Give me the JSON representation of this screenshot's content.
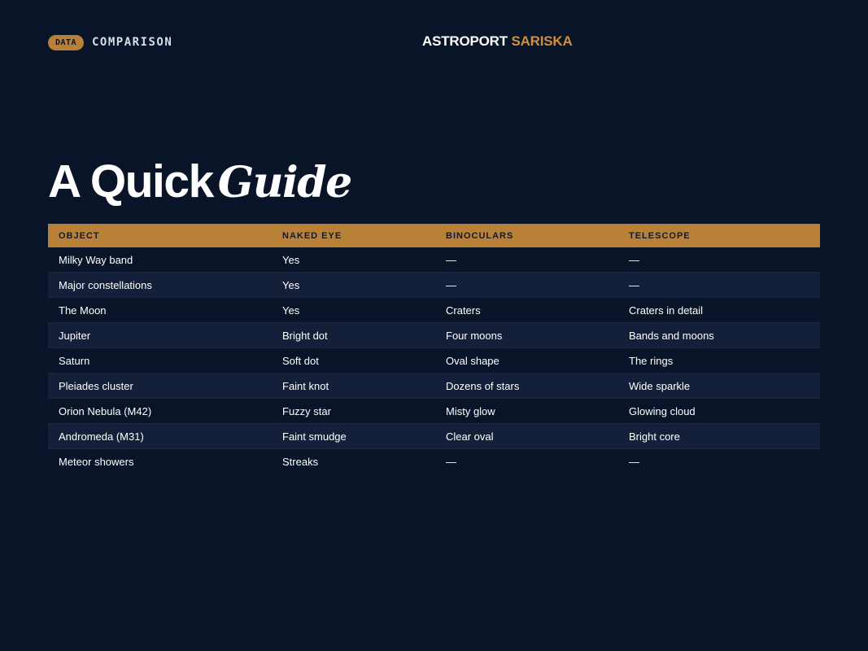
{
  "header": {
    "tag": "DATA",
    "section": "COMPARISON",
    "brand_part1": "ASTROPORT",
    "brand_part2": "SARISKA"
  },
  "title": {
    "part1": "A Quick",
    "part2": "Guide"
  },
  "colors": {
    "background": "#0a1428",
    "accent": "#b98138",
    "brand_accent": "#d08f3f",
    "row_alt": "#14203a"
  },
  "table": {
    "columns": [
      "OBJECT",
      "NAKED EYE",
      "BINOCULARS",
      "TELESCOPE"
    ],
    "rows": [
      [
        "Milky Way band",
        "Yes",
        "—",
        "—"
      ],
      [
        "Major constellations",
        "Yes",
        "—",
        "—"
      ],
      [
        "The Moon",
        "Yes",
        "Craters",
        "Craters in detail"
      ],
      [
        "Jupiter",
        "Bright dot",
        "Four moons",
        "Bands and moons"
      ],
      [
        "Saturn",
        "Soft dot",
        "Oval shape",
        "The rings"
      ],
      [
        "Pleiades cluster",
        "Faint knot",
        "Dozens of stars",
        "Wide sparkle"
      ],
      [
        "Orion Nebula (M42)",
        "Fuzzy star",
        "Misty glow",
        "Glowing cloud"
      ],
      [
        "Andromeda (M31)",
        "Faint smudge",
        "Clear oval",
        "Bright core"
      ],
      [
        "Meteor showers",
        "Streaks",
        "—",
        "—"
      ]
    ]
  }
}
